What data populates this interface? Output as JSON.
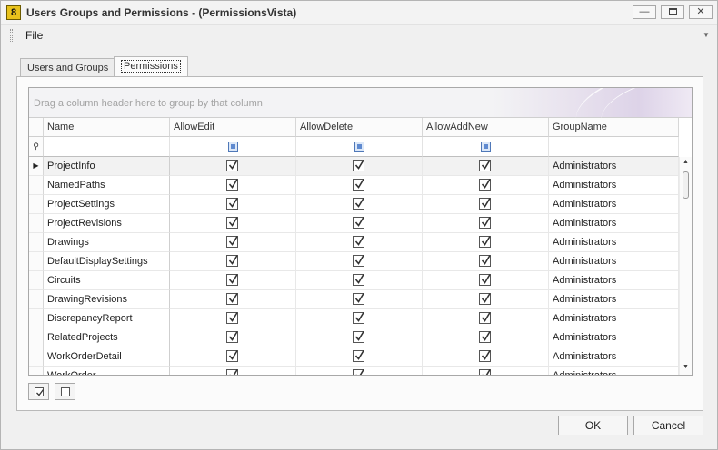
{
  "window": {
    "title": "Users Groups and Permissions - (PermissionsVista)",
    "icon": "app-icon",
    "icon_glyph": "8"
  },
  "menu": {
    "file": "File"
  },
  "tabs": [
    {
      "label": "Users and Groups",
      "active": false
    },
    {
      "label": "Permissions",
      "active": true
    }
  ],
  "grid": {
    "group_hint": "Drag a column header here to group by that column",
    "columns": [
      "Name",
      "AllowEdit",
      "AllowDelete",
      "AllowAddNew",
      "GroupName"
    ],
    "rows": [
      {
        "name": "ProjectInfo",
        "edit": true,
        "delete": true,
        "add": true,
        "group": "Administrators",
        "focused": true
      },
      {
        "name": "NamedPaths",
        "edit": true,
        "delete": true,
        "add": true,
        "group": "Administrators"
      },
      {
        "name": "ProjectSettings",
        "edit": true,
        "delete": true,
        "add": true,
        "group": "Administrators"
      },
      {
        "name": "ProjectRevisions",
        "edit": true,
        "delete": true,
        "add": true,
        "group": "Administrators"
      },
      {
        "name": "Drawings",
        "edit": true,
        "delete": true,
        "add": true,
        "group": "Administrators"
      },
      {
        "name": "DefaultDisplaySettings",
        "edit": true,
        "delete": true,
        "add": true,
        "group": "Administrators"
      },
      {
        "name": "Circuits",
        "edit": true,
        "delete": true,
        "add": true,
        "group": "Administrators"
      },
      {
        "name": "DrawingRevisions",
        "edit": true,
        "delete": true,
        "add": true,
        "group": "Administrators"
      },
      {
        "name": "DiscrepancyReport",
        "edit": true,
        "delete": true,
        "add": true,
        "group": "Administrators"
      },
      {
        "name": "RelatedProjects",
        "edit": true,
        "delete": true,
        "add": true,
        "group": "Administrators"
      },
      {
        "name": "WorkOrderDetail",
        "edit": true,
        "delete": true,
        "add": true,
        "group": "Administrators"
      },
      {
        "name": "WorkOrder",
        "edit": true,
        "delete": true,
        "add": true,
        "group": "Administrators"
      }
    ]
  },
  "buttons": {
    "ok": "OK",
    "cancel": "Cancel"
  }
}
